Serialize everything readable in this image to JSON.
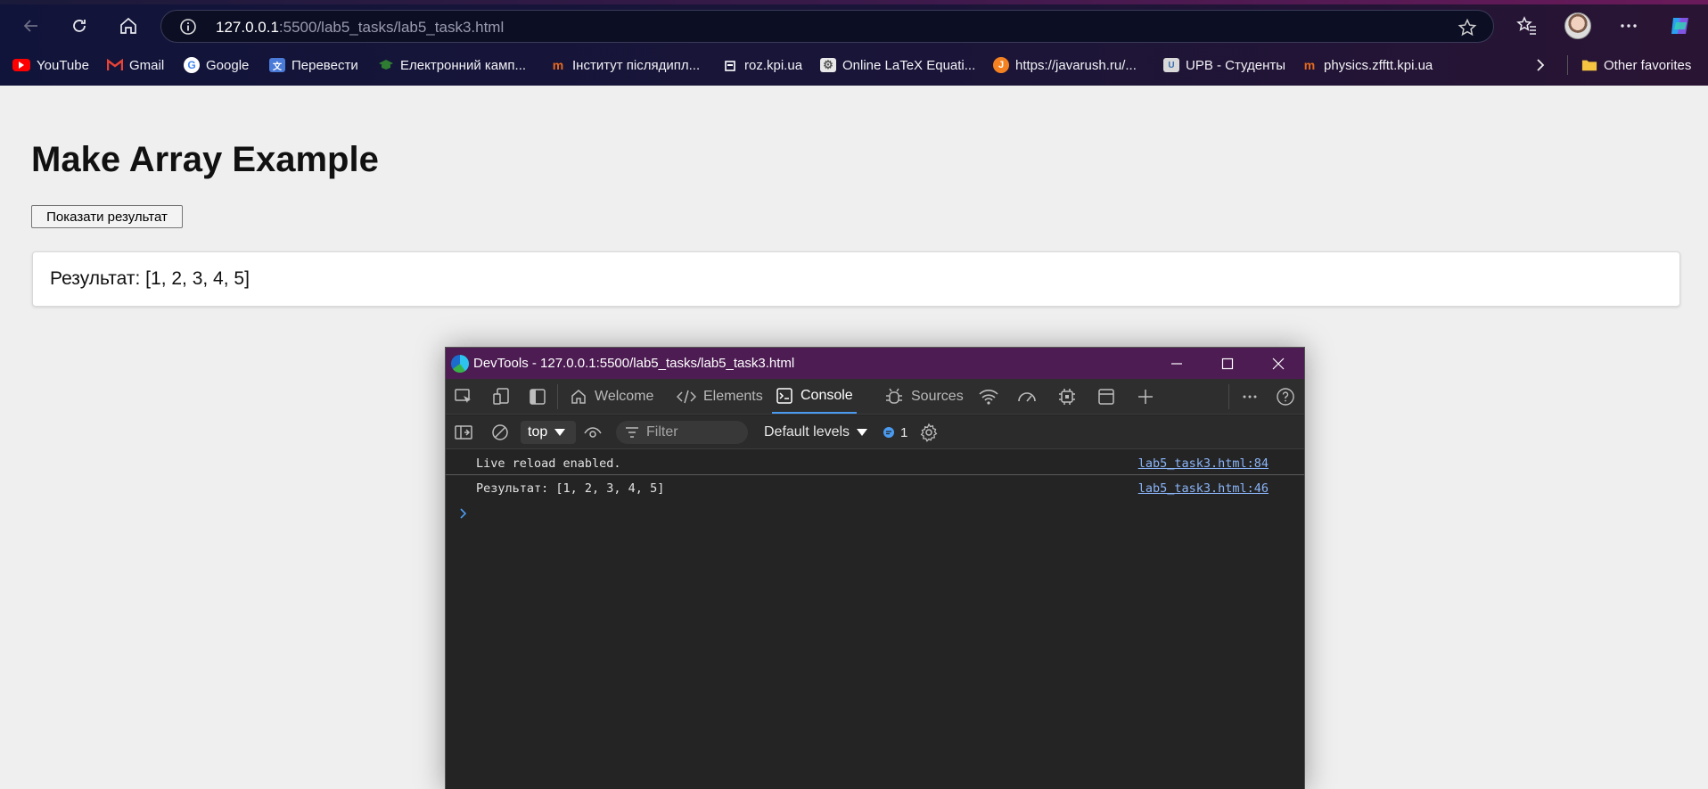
{
  "browser": {
    "url_host": "127.0.0.1",
    "url_rest": ":5500/lab5_tasks/lab5_task3.html",
    "bookmarks": [
      {
        "label": "YouTube",
        "icon": "youtube-icon",
        "color": "#ff0000"
      },
      {
        "label": "Gmail",
        "icon": "gmail-icon",
        "color": "#ea4335"
      },
      {
        "label": "Google",
        "icon": "google-icon",
        "color": "#4285f4"
      },
      {
        "label": "Перевести",
        "icon": "translate-icon",
        "color": "#4b7bd8"
      },
      {
        "label": "Електронний камп...",
        "icon": "graduation-cap-icon",
        "color": "#2e7d32"
      },
      {
        "label": "Інститут післядипл...",
        "icon": "institute-icon",
        "color": "#e66a1f"
      },
      {
        "label": "roz.kpi.ua",
        "icon": "calendar-icon",
        "color": "#ffffff"
      },
      {
        "label": "Online LaTeX Equati...",
        "icon": "gear-icon",
        "color": "#cccccc"
      },
      {
        "label": "https://javarush.ru/...",
        "icon": "javarush-icon",
        "color": "#f58220"
      },
      {
        "label": "UPB - Студенты",
        "icon": "upb-icon",
        "color": "#c9c9c9"
      },
      {
        "label": "physics.zfftt.kpi.ua",
        "icon": "physics-icon",
        "color": "#e66a1f"
      }
    ],
    "other_favorites": "Other favorites"
  },
  "page": {
    "title": "Make Array Example",
    "button_label": "Показати результат",
    "result_text": "Результат: [1, 2, 3, 4, 5]"
  },
  "devtools": {
    "title": "DevTools - 127.0.0.1:5500/lab5_tasks/lab5_task3.html",
    "tabs": {
      "welcome": "Welcome",
      "elements": "Elements",
      "console": "Console",
      "sources": "Sources"
    },
    "context": "top",
    "filter_placeholder": "Filter",
    "levels": "Default levels",
    "issues_count": "1",
    "logs": [
      {
        "message": "Live reload enabled.",
        "source": "lab5_task3.html:84"
      },
      {
        "message": "Результат: [1, 2, 3, 4, 5]",
        "source": "lab5_task3.html:46"
      }
    ]
  }
}
